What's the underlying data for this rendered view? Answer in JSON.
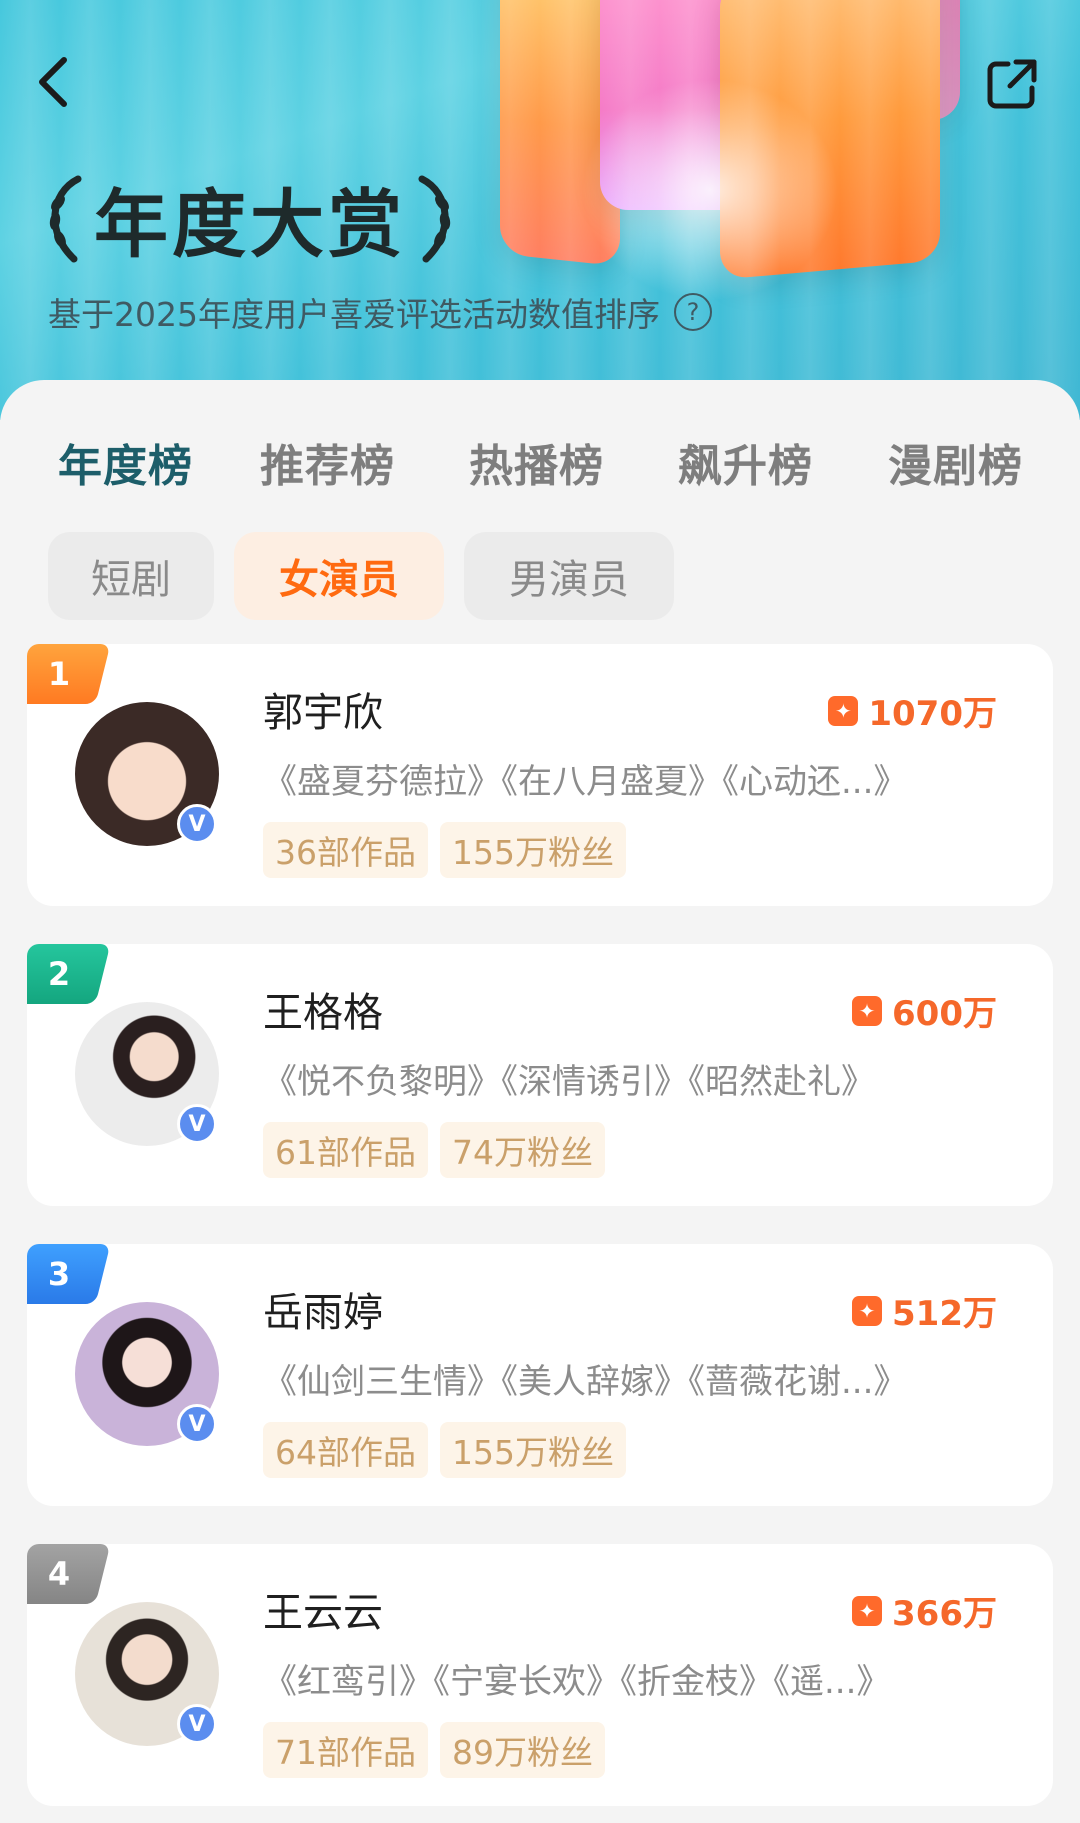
{
  "header": {
    "title": "年度大赏",
    "subtitle": "基于2025年度用户喜爱评选活动数值排序",
    "help_icon": "?"
  },
  "tabs": [
    "年度榜",
    "推荐榜",
    "热播榜",
    "飙升榜",
    "漫剧榜"
  ],
  "subtabs": [
    "短剧",
    "女演员",
    "男演员"
  ],
  "actresses": [
    {
      "rank": "1",
      "rank_color": "#ff8a25",
      "name": "郭宇欣",
      "score": "1070万",
      "works": "《盛夏芬德拉》《在八月盛夏》《心动还...》",
      "tags": [
        "36部作品",
        "155万粉丝"
      ],
      "verified": "V"
    },
    {
      "rank": "2",
      "rank_color": "#1ab58f",
      "name": "王格格",
      "score": "600万",
      "works": "《悦不负黎明》《深情诱引》《昭然赴礼》",
      "tags": [
        "61部作品",
        "74万粉丝"
      ],
      "verified": "V"
    },
    {
      "rank": "3",
      "rank_color": "#2f8df0",
      "name": "岳雨婷",
      "score": "512万",
      "works": "《仙剑三生情》《美人辞嫁》《蔷薇花谢...》",
      "tags": [
        "64部作品",
        "155万粉丝"
      ],
      "verified": "V"
    },
    {
      "rank": "4",
      "rank_color": "#8f8f8f",
      "name": "王云云",
      "score": "366万",
      "works": "《红鸾引》《宁宴长欢》《折金枝》《遥...》",
      "tags": [
        "71部作品",
        "89万粉丝"
      ],
      "verified": "V"
    }
  ]
}
